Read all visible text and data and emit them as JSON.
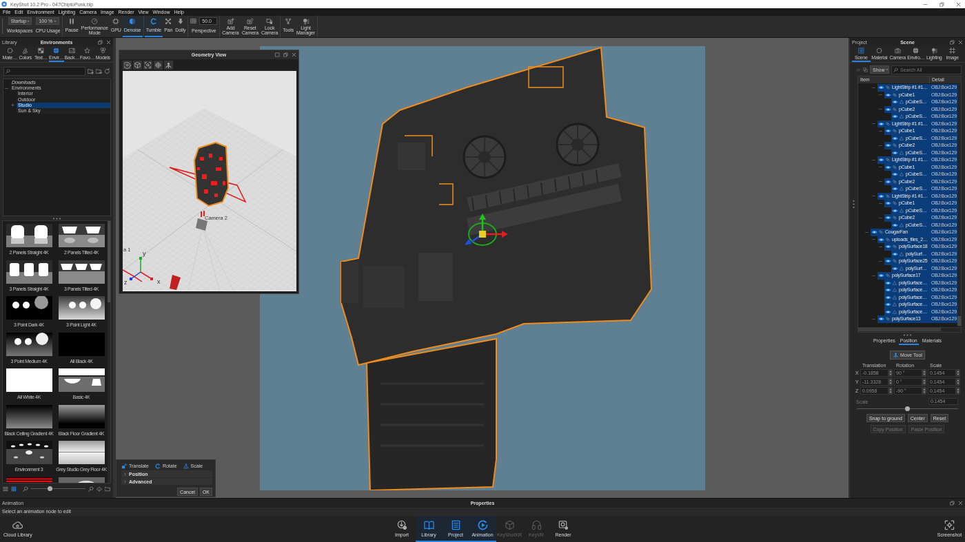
{
  "window": {
    "title": "KeyShot 10.2 Pro - 047ChiptoPunk.bip"
  },
  "menu": [
    "File",
    "Edit",
    "Environment",
    "Lighting",
    "Camera",
    "Image",
    "Render",
    "View",
    "Window",
    "Help"
  ],
  "toolbar": [
    [
      {
        "kind": "dropdown",
        "value": "Startup",
        "label": "Workspaces"
      },
      {
        "kind": "dropdown",
        "value": "100 %",
        "label": "CPU Usage"
      }
    ],
    [
      {
        "kind": "button",
        "label": "Pause",
        "selected": false
      },
      {
        "kind": "button",
        "label": "Performance Mode",
        "selected": false
      },
      {
        "kind": "button",
        "label": "GPU",
        "selected": false
      },
      {
        "kind": "button",
        "label": "Denoise",
        "selected": true
      }
    ],
    [
      {
        "kind": "button",
        "label": "Tumble",
        "selected": true
      },
      {
        "kind": "button",
        "label": "Pan",
        "selected": false
      },
      {
        "kind": "button",
        "label": "Dolly",
        "selected": false
      }
    ],
    [
      {
        "kind": "field",
        "value": "50.0",
        "label": "Perspective"
      }
    ],
    [
      {
        "kind": "button",
        "label": "Add Camera",
        "selected": false
      },
      {
        "kind": "button",
        "label": "Reset Camera",
        "selected": false
      },
      {
        "kind": "button",
        "label": "Lock Camera",
        "selected": false
      }
    ],
    [
      {
        "kind": "button",
        "label": "Tools",
        "selected": false
      },
      {
        "kind": "button",
        "label": "Light Manager",
        "selected": false
      }
    ]
  ],
  "library": {
    "title": "Library",
    "heading": "Environments",
    "tabs": [
      {
        "label": "Mate…",
        "selected": false
      },
      {
        "label": "Colors",
        "selected": false
      },
      {
        "label": "Text…",
        "selected": false
      },
      {
        "label": "Envir…",
        "selected": true
      },
      {
        "label": "Back…",
        "selected": false
      },
      {
        "label": "Favo…",
        "selected": false
      },
      {
        "label": "Models",
        "selected": false
      }
    ],
    "tree": [
      {
        "label": "Downloads",
        "kind": "virtual",
        "selected": false
      },
      {
        "label": "Environments",
        "kind": "folder",
        "selected": false,
        "expanded": true,
        "children": [
          {
            "label": "Interior",
            "kind": "folder",
            "selected": false
          },
          {
            "label": "Outdoor",
            "kind": "folder",
            "selected": false
          },
          {
            "label": "Studio",
            "kind": "folder",
            "selected": true,
            "expanded": false
          },
          {
            "label": "Sun & Sky",
            "kind": "folder",
            "selected": false
          }
        ]
      }
    ],
    "environments": [
      "2 Panels Straight 4K",
      "2 Panels Tilted 4K",
      "3 Panels Straight 4K",
      "3 Panels Tilted 4K",
      "3 Point Dark 4K",
      "3 Point Light 4K",
      "3 Point Medium 4K",
      "All Black 4K",
      "All White 4K",
      "Basic 4K",
      "Black Ceiling Gradient 4K",
      "Black Floor Gradient 4K",
      "Environment 3",
      "Grey Studio Grey Floor 4K"
    ],
    "view_modes": [
      {
        "kind": "list",
        "selected": false
      },
      {
        "kind": "grid",
        "selected": true
      }
    ],
    "thumbnail_size": {
      "level": 0.35
    }
  },
  "geometry_view": {
    "title": "Geometry View",
    "camera_labels": [
      "Camera 2",
      "a 1"
    ],
    "axis_labels": [
      "y",
      "z",
      "x"
    ]
  },
  "transform_panel": {
    "modes": [
      "Translate",
      "Rotate",
      "Scale"
    ],
    "sections": [
      {
        "label": "Position",
        "expanded": false
      },
      {
        "label": "Advanced",
        "expanded": false
      }
    ],
    "buttons": [
      "Cancel",
      "OK"
    ]
  },
  "project": {
    "title": "Project",
    "heading": "Scene",
    "tabs": [
      {
        "label": "Scene",
        "selected": true
      },
      {
        "label": "Material",
        "selected": false
      },
      {
        "label": "Camera",
        "selected": false
      },
      {
        "label": "Enviro…",
        "selected": false
      },
      {
        "label": "Lighting",
        "selected": false
      },
      {
        "label": "Image",
        "selected": false
      }
    ],
    "filter": "Show",
    "search": {
      "placeholder": "Search All"
    },
    "columns": [
      "Item",
      "Detail"
    ],
    "tree_continued": [
      {
        "label": "LightStrip #1 #1…",
        "detail": "OBJ:Box129",
        "kind": "group",
        "visible": true,
        "selected": true,
        "expanded": true,
        "children": [
          {
            "label": "pCube1",
            "detail": "OBJ:Box129",
            "kind": "group",
            "visible": true,
            "selected": true,
            "expanded": true,
            "children": [
              {
                "label": "pCubeS…",
                "detail": "OBJ:Box129",
                "kind": "part",
                "visible": true,
                "selected": true
              }
            ]
          },
          {
            "label": "pCube2",
            "detail": "OBJ:Box129",
            "kind": "group",
            "visible": true,
            "selected": true,
            "expanded": true,
            "children": [
              {
                "label": "pCubeS…",
                "detail": "OBJ:Box129",
                "kind": "part",
                "visible": true,
                "selected": true
              }
            ]
          }
        ]
      },
      {
        "label": "LightStrip #1 #1…",
        "detail": "OBJ:Box129",
        "kind": "group",
        "visible": true,
        "selected": true,
        "expanded": true,
        "children": [
          {
            "label": "pCube1",
            "detail": "OBJ:Box129",
            "kind": "group",
            "visible": true,
            "selected": true,
            "expanded": true,
            "children": [
              {
                "label": "pCubeS…",
                "detail": "OBJ:Box129",
                "kind": "part",
                "visible": true,
                "selected": true
              }
            ]
          },
          {
            "label": "pCube2",
            "detail": "OBJ:Box129",
            "kind": "group",
            "visible": true,
            "selected": true,
            "expanded": true,
            "children": [
              {
                "label": "pCubeS…",
                "detail": "OBJ:Box129",
                "kind": "part",
                "visible": true,
                "selected": true
              }
            ]
          }
        ]
      },
      {
        "label": "LightStrip #1 #1…",
        "detail": "OBJ:Box129",
        "kind": "group",
        "visible": true,
        "selected": true,
        "expanded": true,
        "children": [
          {
            "label": "pCube1",
            "detail": "OBJ:Box129",
            "kind": "group",
            "visible": true,
            "selected": true,
            "expanded": true,
            "children": [
              {
                "label": "pCubeS…",
                "detail": "OBJ:Box129",
                "kind": "part",
                "visible": true,
                "selected": true
              }
            ]
          },
          {
            "label": "pCube2",
            "detail": "OBJ:Box129",
            "kind": "group",
            "visible": true,
            "selected": true,
            "expanded": true,
            "children": [
              {
                "label": "pCubeS…",
                "detail": "OBJ:Box129",
                "kind": "part",
                "visible": true,
                "selected": true
              }
            ]
          }
        ]
      },
      {
        "label": "LightStrip #1 #1…",
        "detail": "OBJ:Box129",
        "kind": "group",
        "visible": true,
        "selected": true,
        "expanded": true,
        "children": [
          {
            "label": "pCube1",
            "detail": "OBJ:Box129",
            "kind": "group",
            "visible": true,
            "selected": true,
            "expanded": true,
            "children": [
              {
                "label": "pCubeS…",
                "detail": "OBJ:Box129",
                "kind": "part",
                "visible": true,
                "selected": true
              }
            ]
          },
          {
            "label": "pCube2",
            "detail": "OBJ:Box129",
            "kind": "group",
            "visible": true,
            "selected": true,
            "expanded": true,
            "children": [
              {
                "label": "pCubeS…",
                "detail": "OBJ:Box129",
                "kind": "part",
                "visible": true,
                "selected": true
              }
            ]
          }
        ]
      }
    ],
    "tree": [
      {
        "label": "CougarFan",
        "detail": "OBJ:Box129",
        "kind": "group",
        "visible": true,
        "selected": true,
        "expanded": true,
        "children": [
          {
            "label": "uploads_files_2…",
            "detail": "OBJ:Box129",
            "kind": "group",
            "visible": true,
            "selected": true,
            "expanded": true,
            "children": [
              {
                "label": "polySurface18",
                "detail": "OBJ:Box129",
                "kind": "group",
                "visible": true,
                "selected": true,
                "expanded": true,
                "children": [
                  {
                    "label": "polySurf…",
                    "detail": "OBJ:Box129",
                    "kind": "part",
                    "visible": true,
                    "selected": true
                  }
                ]
              },
              {
                "label": "polySurface25",
                "detail": "OBJ:Box129",
                "kind": "group",
                "visible": true,
                "selected": true,
                "expanded": true,
                "children": [
                  {
                    "label": "polySurf…",
                    "detail": "OBJ:Box129",
                    "kind": "part",
                    "visible": true,
                    "selected": true
                  }
                ]
              }
            ]
          },
          {
            "label": "polySurface17",
            "detail": "OBJ:Box129",
            "kind": "group",
            "visible": true,
            "selected": true,
            "expanded": true,
            "children": [
              {
                "label": "polySurface…",
                "detail": "OBJ:Box129",
                "kind": "part",
                "visible": true,
                "selected": true
              },
              {
                "label": "polySurface…",
                "detail": "OBJ:Box129",
                "kind": "part",
                "visible": true,
                "selected": true
              },
              {
                "label": "polySurface…",
                "detail": "OBJ:Box129",
                "kind": "part",
                "visible": true,
                "selected": true
              },
              {
                "label": "polySurface…",
                "detail": "OBJ:Box129",
                "kind": "part",
                "visible": true,
                "selected": true
              },
              {
                "label": "polySurface…",
                "detail": "OBJ:Box129",
                "kind": "part",
                "visible": true,
                "selected": true
              }
            ]
          },
          {
            "label": "polySurface13",
            "detail": "OBJ:Box129",
            "kind": "group",
            "visible": true,
            "selected": true,
            "expanded": true
          }
        ]
      }
    ]
  },
  "position": {
    "tabs": [
      {
        "label": "Properties",
        "selected": false
      },
      {
        "label": "Position",
        "selected": true
      },
      {
        "label": "Materials",
        "selected": false
      }
    ],
    "move_tool": "Move Tool",
    "columns": [
      "Translation",
      "Rotation",
      "Scale"
    ],
    "rows": [
      {
        "axis": "X",
        "values": [
          "-0.1858",
          "90 °",
          "0.1454"
        ]
      },
      {
        "axis": "Y",
        "values": [
          "-11.3328",
          "0 °",
          "0.1454"
        ]
      },
      {
        "axis": "Z",
        "values": [
          "0.0958",
          "-90 °",
          "0.1454"
        ]
      }
    ],
    "scale": {
      "label": "Scale",
      "value": "0.1454",
      "level": 0.5
    },
    "buttons": [
      [
        {
          "label": "Snap to ground",
          "disabled": false
        },
        {
          "label": "Center",
          "disabled": false
        },
        {
          "label": "Reset",
          "disabled": false
        }
      ],
      [
        {
          "label": "Copy Position",
          "disabled": true
        },
        {
          "label": "Paste Position",
          "disabled": true
        }
      ]
    ]
  },
  "animation": {
    "title": "Animation",
    "heading": "Properties",
    "message": "Select an animation node to edit"
  },
  "ribbon": {
    "left": [
      {
        "label": "Cloud Library",
        "selected": false,
        "disabled": false
      }
    ],
    "center": [
      {
        "label": "Import",
        "selected": false,
        "disabled": false
      },
      {
        "label": "Library",
        "selected": true,
        "disabled": false
      },
      {
        "label": "Project",
        "selected": true,
        "disabled": false
      },
      {
        "label": "Animation",
        "selected": true,
        "disabled": false
      },
      {
        "label": "KeyShotXR",
        "selected": false,
        "disabled": true
      },
      {
        "label": "KeyVR",
        "selected": false,
        "disabled": true
      },
      {
        "label": "Render",
        "selected": false,
        "disabled": false
      }
    ],
    "right": [
      {
        "label": "Screenshot",
        "selected": false,
        "disabled": false
      }
    ]
  }
}
